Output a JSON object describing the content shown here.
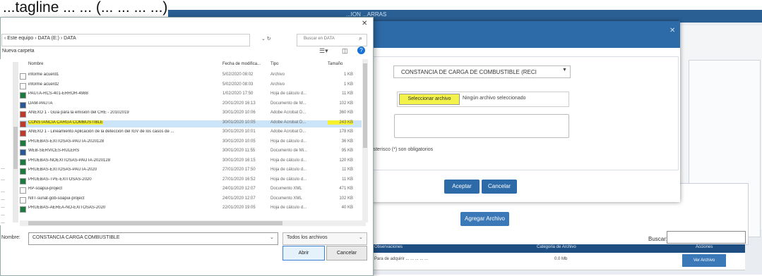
{
  "caption": {
    "text": "...tagline ... ... (... ... ... ...)",
    "end": ")"
  },
  "background": {
    "topbar_title": "...ION ...ARRAS",
    "agregar_button": "Agregar Archivo",
    "buscar_label": "Buscar:",
    "table_headers": [
      "Observaciones",
      "Categoria de Archivo",
      "Acciones"
    ],
    "table_row": {
      "obs": "Para de adquirir ... ... ... ... ...",
      "cat": "0.0 Mb",
      "action": "Ver Archivo"
    }
  },
  "modal": {
    "select_value": "CONSTANCIA DE CARGA DE COMBUSTIBLE (RECI",
    "file_button": "Seleccionar archivo",
    "file_status": "Ningún archivo seleccionado",
    "required_text": "e asterisco (*) son obligatorios",
    "accept": "Aceptar",
    "cancel": "Cancelar"
  },
  "dialog": {
    "address": "‹ Este equipo › DATA (E:) › DATA",
    "search_placeholder": "Buscar en DATA",
    "organize": "Nueva carpeta",
    "columns": {
      "name": "Nombre",
      "date": "Fecha de modifica...",
      "type": "Tipo",
      "size": "Tamaño"
    },
    "nav_labels": [
      "...",
      "...",
      "...",
      "...",
      "...",
      "...",
      "..."
    ],
    "files": [
      {
        "name": "informe acuerd1",
        "date": "5/02/2020 08:02",
        "type": "Archivo",
        "size": "1 KB",
        "icon": "blank"
      },
      {
        "name": "informe acuerd2",
        "date": "5/02/2020 08:03",
        "type": "Archivo",
        "size": "1 KB",
        "icon": "blank"
      },
      {
        "name": "PAUTA-RCS-401-ERROR-4988",
        "date": "1/02/2020 17:50",
        "type": "Hoja de cálculo d...",
        "size": "11 KB",
        "icon": "excel"
      },
      {
        "name": "DAM-PAUTA",
        "date": "20/01/2020 16:13",
        "type": "Documento de M...",
        "size": "102 KB",
        "icon": "word"
      },
      {
        "name": "ANEXO 1 - Guía para la emisión del CRE - 20102019",
        "date": "30/01/2020 10:06",
        "type": "Adobe Acrobat D...",
        "size": "360 KB",
        "icon": "pdf"
      },
      {
        "name": "CONSTANCIA CARGA COMBUSTIBLE",
        "date": "30/01/2020 10:05",
        "type": "Adobe Acrobat D...",
        "size": "243 KB",
        "icon": "pdf",
        "selected": true
      },
      {
        "name": "ANEXO 1 - Lineamiento Aplicación de la detección del IGV de los casos de ...",
        "date": "30/01/2020 10:01",
        "type": "Adobe Acrobat D...",
        "size": "178 KB",
        "icon": "pdf"
      },
      {
        "name": "PRUEBAS-EXITOSAS-PAUTA-2020128",
        "date": "30/01/2020 10:05",
        "type": "Hoja de cálculo d...",
        "size": "36 KB",
        "icon": "excel"
      },
      {
        "name": "WEB-SERVICES-RULERS",
        "date": "30/01/2020 11:55",
        "type": "Documento de Mi...",
        "size": "95 KB",
        "icon": "word"
      },
      {
        "name": "PRUEBAS-NOEXITOSAS-PAUTA-2020128",
        "date": "30/01/2020 16:15",
        "type": "Hoja de cálculo d...",
        "size": "120 KB",
        "icon": "excel"
      },
      {
        "name": "PRUEBAS-EXITOSAS-PAUTA-2020",
        "date": "27/01/2020 17:50",
        "type": "Hoja de cálculo d...",
        "size": "11 KB",
        "icon": "excel"
      },
      {
        "name": "PRUEBAS-TPE-EXITOSAS-2020",
        "date": "27/01/2020 16:52",
        "type": "Hoja de cálculo d...",
        "size": "11 KB",
        "icon": "excel"
      },
      {
        "name": "RP-soapui-project",
        "date": "24/01/2020 12:07",
        "type": "Documento XML",
        "size": "471 KB",
        "icon": "blank"
      },
      {
        "name": "NIIT-sunat-gob-soapui-project",
        "date": "24/01/2020 12:07",
        "type": "Documento XML",
        "size": "102 KB",
        "icon": "blank"
      },
      {
        "name": "PRUEBAS-AEREA-NO-EXITOSAS-2020",
        "date": "22/01/2020 19:05",
        "type": "Hoja de cálculo d...",
        "size": "40 KB",
        "icon": "excel"
      }
    ],
    "nombre_label": "Nombre:",
    "nombre_value": "CONSTANCIA CARGA COMBUSTIBLE",
    "filter_value": "Todos los archivos",
    "open": "Abrir",
    "cancel": "Cancelar"
  },
  "colors": {
    "accent": "#2d6aa8",
    "highlight": "#f5f22d",
    "selection": "#cce4f7"
  }
}
